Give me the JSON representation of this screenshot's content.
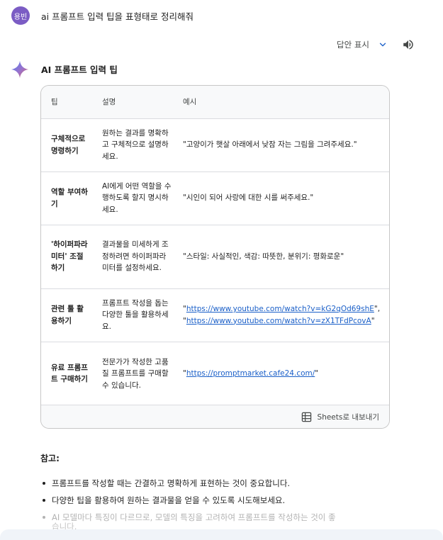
{
  "user": {
    "avatar_text": "용빈",
    "prompt": "ai 프롬프트 입력 팁을 표형태로 정리해줘"
  },
  "toolbar": {
    "show_drafts_label": "답안 표시",
    "chevron_icon": "chevron-down-icon",
    "speaker_icon": "volume-icon"
  },
  "response": {
    "title": "AI 프롬프트 입력 팁",
    "table": {
      "headers": [
        "팁",
        "설명",
        "예시"
      ],
      "rows": [
        {
          "tip": "구체적으로 명령하기",
          "desc": "원하는 결과를 명확하고 구체적으로 설명하세요.",
          "example": "\"고양이가 햇살 아래에서 낮잠 자는 그림을 그려주세요.\""
        },
        {
          "tip": "역할 부여하기",
          "desc": "AI에게 어떤 역할을 수행하도록 할지 명시하세요.",
          "example": "\"시인이 되어 사랑에 대한 시를 써주세요.\""
        },
        {
          "tip": "'하이퍼파라미터' 조절하기",
          "desc": "결과물을 미세하게 조정하려면 하이퍼파라미터를 설정하세요.",
          "example": "\"스타일: 사실적인, 색감: 따뜻한, 분위기: 평화로운\""
        },
        {
          "tip": "관련 툴 활용하기",
          "desc": "프롬프트 작성을 돕는 다양한 툴을 활용하세요.",
          "link1": "https://www.youtube.com/watch?v=kG2qOd69shE",
          "link2": "https://www.youtube.com/watch?v=zX1TFdPcovA"
        },
        {
          "tip": "유료 프롬프트 구매하기",
          "desc": "전문가가 작성한 고품질 프롬프트를 구매할 수 있습니다.",
          "link1": "https://promptmarket.cafe24.com/"
        }
      ],
      "export_label": "Sheets로 내보내기"
    },
    "note_title": "참고:",
    "notes": [
      "프롬프트를 작성할 때는 간결하고 명확하게 표현하는 것이 중요합니다.",
      "다양한 팁을 활용하여 원하는 결과물을 얻을 수 있도록 시도해보세요.",
      "AI 모델마다 특징이 다르므로, 모델의 특징을 고려하여 프롬프트를 작성하는 것이 좋",
      "습니다."
    ]
  },
  "colors": {
    "avatar_bg": "#7b5cc4",
    "link": "#1a5fc8",
    "sparkle_start": "#4f7cf0",
    "sparkle_end": "#d6645d"
  }
}
